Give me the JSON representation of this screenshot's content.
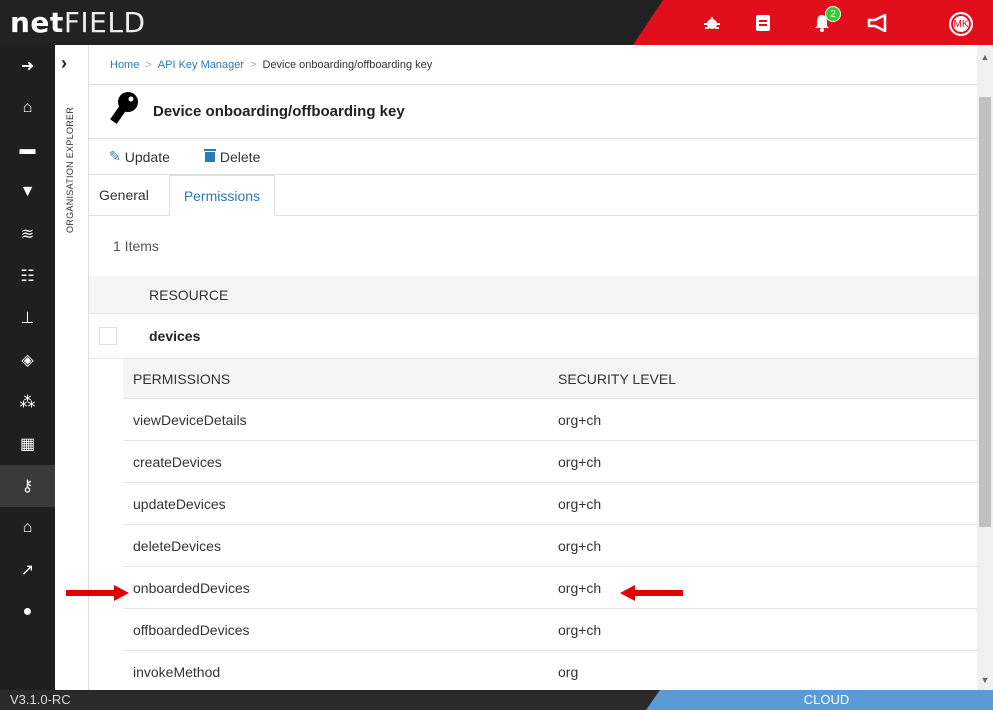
{
  "header": {
    "brand_bold": "net",
    "brand_light": "FIELD",
    "notifications_count": "2",
    "avatar_initials": "MK"
  },
  "nav": {
    "items": [
      {
        "icon": "arrow-right-icon",
        "glyph": "➜"
      },
      {
        "icon": "home-icon",
        "glyph": "⌂"
      },
      {
        "icon": "device-icon",
        "glyph": "▬"
      },
      {
        "icon": "filter-icon",
        "glyph": "▼"
      },
      {
        "icon": "layers-icon",
        "glyph": "≋"
      },
      {
        "icon": "checklist-icon",
        "glyph": "☷"
      },
      {
        "icon": "hierarchy-icon",
        "glyph": "⊥"
      },
      {
        "icon": "cube-icon",
        "glyph": "◈"
      },
      {
        "icon": "cubes-icon",
        "glyph": "⁂"
      },
      {
        "icon": "building-icon",
        "glyph": "▦"
      },
      {
        "icon": "key-icon",
        "glyph": "⚷"
      },
      {
        "icon": "house-icon",
        "glyph": "⌂"
      },
      {
        "icon": "chart-icon",
        "glyph": "↗"
      },
      {
        "icon": "location-pin-icon",
        "glyph": "●"
      }
    ]
  },
  "explorer": {
    "label": "ORGANISATION EXPLORER"
  },
  "breadcrumb": {
    "home": "Home",
    "api": "API Key Manager",
    "current": "Device onboarding/offboarding key"
  },
  "page": {
    "title": "Device onboarding/offboarding key",
    "update_label": "Update",
    "delete_label": "Delete"
  },
  "tabs": {
    "general": "General",
    "permissions": "Permissions"
  },
  "table": {
    "count_label": "1 Items",
    "resource_header": "RESOURCE",
    "resource_name": "devices",
    "perm_header": "PERMISSIONS",
    "level_header": "SECURITY LEVEL",
    "rows": [
      {
        "permission": "viewDeviceDetails",
        "level": "org+ch"
      },
      {
        "permission": "createDevices",
        "level": "org+ch"
      },
      {
        "permission": "updateDevices",
        "level": "org+ch"
      },
      {
        "permission": "deleteDevices",
        "level": "org+ch"
      },
      {
        "permission": "onboardedDevices",
        "level": "org+ch"
      },
      {
        "permission": "offboardedDevices",
        "level": "org+ch"
      },
      {
        "permission": "invokeMethod",
        "level": "org"
      }
    ]
  },
  "footer": {
    "version": "V3.1.0-RC",
    "env": "CLOUD"
  },
  "colors": {
    "accent": "#e10e1c",
    "link": "#2a7ab8",
    "annotation_arrow": "#e00000"
  }
}
